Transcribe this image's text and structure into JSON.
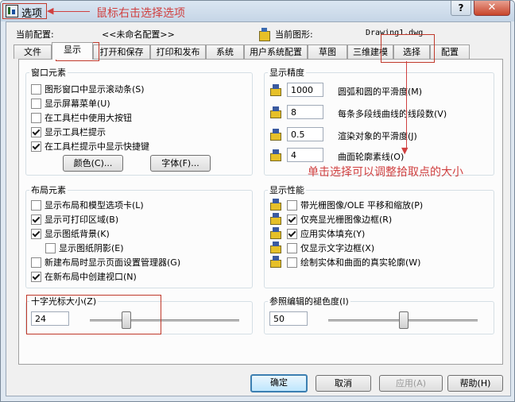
{
  "window": {
    "title": "选项"
  },
  "annotations": {
    "right_click": "鼠标右击选择选项",
    "pickbox": "单击选择可以调整拾取点的大小",
    "color": "#d04040"
  },
  "header": {
    "current_profile_label": "当前配置:",
    "current_profile_value": "<<未命名配置>>",
    "current_drawing_label": "当前图形:",
    "current_drawing_value": "Drawing1.dwg"
  },
  "tabs": [
    {
      "label": "文件",
      "active": false
    },
    {
      "label": "显示",
      "active": true
    },
    {
      "label": "打开和保存",
      "active": false
    },
    {
      "label": "打印和发布",
      "active": false
    },
    {
      "label": "系统",
      "active": false
    },
    {
      "label": "用户系统配置",
      "active": false
    },
    {
      "label": "草图",
      "active": false
    },
    {
      "label": "三维建模",
      "active": false
    },
    {
      "label": "选择",
      "active": false
    },
    {
      "label": "配置",
      "active": false
    }
  ],
  "window_elements": {
    "title": "窗口元素",
    "options": [
      {
        "label": "图形窗口中显示滚动条(S)",
        "checked": false
      },
      {
        "label": "显示屏幕菜单(U)",
        "checked": false
      },
      {
        "label": "在工具栏中使用大按钮",
        "checked": false
      },
      {
        "label": "显示工具栏提示",
        "checked": true
      },
      {
        "label": "在工具栏提示中显示快捷键",
        "checked": true
      }
    ],
    "colors_button": "颜色(C)...",
    "fonts_button": "字体(F)..."
  },
  "display_resolution": {
    "title": "显示精度",
    "items": [
      {
        "value": "1000",
        "label": "圆弧和圆的平滑度(M)",
        "icon": "arc-smoothness-icon"
      },
      {
        "value": "8",
        "label": "每条多段线曲线的线段数(V)",
        "icon": "polyline-segments-icon"
      },
      {
        "value": "0.5",
        "label": "渲染对象的平滑度(J)",
        "icon": "render-smoothness-icon"
      },
      {
        "value": "4",
        "label": "曲面轮廓素线(O)",
        "icon": "contour-lines-icon"
      }
    ]
  },
  "layout_elements": {
    "title": "布局元素",
    "options": [
      {
        "label": "显示布局和模型选项卡(L)",
        "checked": false
      },
      {
        "label": "显示可打印区域(B)",
        "checked": true
      },
      {
        "label": "显示图纸背景(K)",
        "checked": true
      },
      {
        "label": "显示图纸阴影(E)",
        "checked": false
      },
      {
        "label": "新建布局时显示页面设置管理器(G)",
        "checked": false
      },
      {
        "label": "在新布局中创建视口(N)",
        "checked": true
      }
    ]
  },
  "display_performance": {
    "title": "显示性能",
    "options": [
      {
        "label": "带光栅图像/OLE 平移和缩放(P)",
        "checked": false
      },
      {
        "label": "仅亮显光栅图像边框(R)",
        "checked": true
      },
      {
        "label": "应用实体填充(Y)",
        "checked": true
      },
      {
        "label": "仅显示文字边框(X)",
        "checked": false
      },
      {
        "label": "绘制实体和曲面的真实轮廓(W)",
        "checked": false
      }
    ]
  },
  "crosshair": {
    "title": "十字光标大小(Z)",
    "value": "24",
    "slider_fraction": 0.24
  },
  "xref_fading": {
    "title": "参照编辑的褪色度(I)",
    "value": "50",
    "slider_fraction": 0.5
  },
  "footer": {
    "ok": "确定",
    "cancel": "取消",
    "apply": "应用(A)",
    "help": "帮助(H)"
  }
}
